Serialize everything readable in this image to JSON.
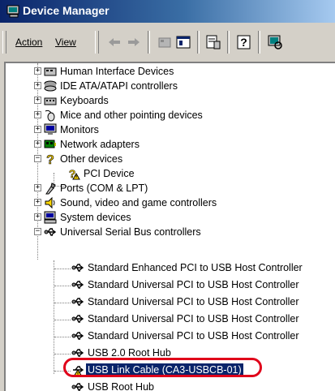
{
  "window": {
    "title": "Device Manager"
  },
  "menu": {
    "action": "Action",
    "view": "View"
  },
  "tree": {
    "items": [
      {
        "label": "Human Interface Devices"
      },
      {
        "label": "IDE ATA/ATAPI controllers"
      },
      {
        "label": "Keyboards"
      },
      {
        "label": "Mice and other pointing devices"
      },
      {
        "label": "Monitors"
      },
      {
        "label": "Network adapters"
      },
      {
        "label": "Other devices"
      },
      {
        "label": "PCI Device"
      },
      {
        "label": "Ports (COM & LPT)"
      },
      {
        "label": "Sound, video and game controllers"
      },
      {
        "label": "System devices"
      },
      {
        "label": "Universal Serial Bus controllers"
      },
      {
        "label": "Standard Enhanced PCI to USB Host Controller"
      },
      {
        "label": "Standard Universal PCI to USB Host Controller"
      },
      {
        "label": "Standard Universal PCI to USB Host Controller"
      },
      {
        "label": "Standard Universal PCI to USB Host Controller"
      },
      {
        "label": "Standard Universal PCI to USB Host Controller"
      },
      {
        "label": "USB 2.0 Root Hub"
      },
      {
        "label": "USB Link Cable (CA3-USBCB-01)"
      },
      {
        "label": "USB Root Hub"
      }
    ]
  },
  "colors": {
    "selection": "#0a246a",
    "highlight_ring": "#e0001a",
    "title_gradient_start": "#0a246a"
  }
}
